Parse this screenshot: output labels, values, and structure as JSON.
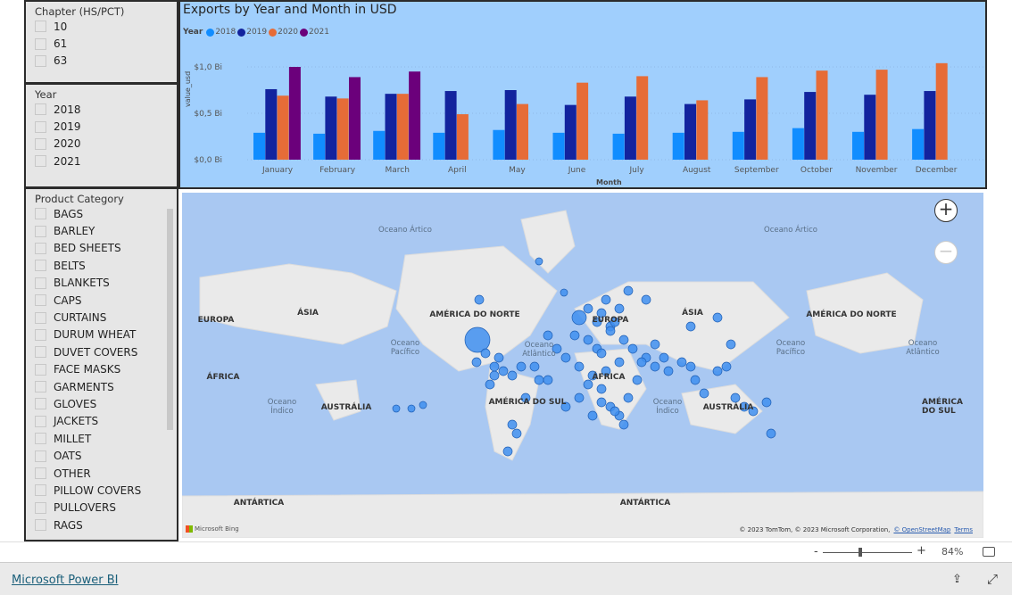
{
  "slicers": {
    "chapter": {
      "title": "Chapter (HS/PCT)",
      "items": [
        "10",
        "61",
        "63"
      ]
    },
    "year": {
      "title": "Year",
      "items": [
        "2018",
        "2019",
        "2020",
        "2021"
      ]
    },
    "product": {
      "title": "Product Category",
      "items": [
        "BAGS",
        "BARLEY",
        "BED SHEETS",
        "BELTS",
        "BLANKETS",
        "CAPS",
        "CURTAINS",
        "DURUM WHEAT",
        "DUVET COVERS",
        "FACE MASKS",
        "GARMENTS",
        "GLOVES",
        "JACKETS",
        "MILLET",
        "OATS",
        "OTHER",
        "PILLOW COVERS",
        "PULLOVERS",
        "RAGS"
      ]
    }
  },
  "chart_data": {
    "type": "bar",
    "title": "Exports by Year and Month in USD",
    "xlabel": "Month",
    "ylabel": "value_usd",
    "legend_title": "Year",
    "legend_placement": "top-left",
    "yticks": [
      "$0,0 Bi",
      "$0,5 Bi",
      "$1,0 Bi"
    ],
    "ylim": [
      0,
      1.1
    ],
    "categories": [
      "January",
      "February",
      "March",
      "April",
      "May",
      "June",
      "July",
      "August",
      "September",
      "October",
      "November",
      "December"
    ],
    "series": [
      {
        "name": "2018",
        "color": "#118dff",
        "values": [
          0.29,
          0.28,
          0.31,
          0.29,
          0.32,
          0.29,
          0.28,
          0.29,
          0.3,
          0.34,
          0.3,
          0.33
        ]
      },
      {
        "name": "2019",
        "color": "#12239e",
        "values": [
          0.76,
          0.68,
          0.71,
          0.74,
          0.75,
          0.59,
          0.68,
          0.6,
          0.65,
          0.73,
          0.7,
          0.74
        ]
      },
      {
        "name": "2020",
        "color": "#e66c37",
        "values": [
          0.69,
          0.66,
          0.71,
          0.49,
          0.6,
          0.83,
          0.9,
          0.64,
          0.89,
          0.96,
          0.97,
          1.04
        ]
      },
      {
        "name": "2021",
        "color": "#6b007b",
        "values": [
          1.0,
          0.89,
          0.95,
          null,
          null,
          null,
          null,
          null,
          null,
          null,
          null,
          null
        ]
      }
    ]
  },
  "map": {
    "labels": [
      "EUROPA",
      "ÁSIA",
      "AMÉRICA DO NORTE",
      "EUROPA",
      "ÁSIA",
      "AMÉRICA DO NORTE",
      "ÁFRICA",
      "AUSTRÁLIA",
      "AMÉRICA DO SUL",
      "ÁFRICA",
      "AUSTRÁLIA",
      "AMÉRICA DO SUL",
      "ANTÁRTICA",
      "ANTÁRTICA"
    ],
    "oceans": [
      "Oceano Ártico",
      "Oceano Ártico",
      "Oceano Pacífico",
      "Oceano Atlântico",
      "Oceano Pacífico",
      "Oceano Índico",
      "Oceano Índico",
      "Oceano Atlântico"
    ],
    "zoom_in": "+",
    "zoom_out": "−",
    "attribution": "© 2023 TomTom, © 2023 Microsoft Corporation,",
    "osm": "© OpenStreetMap",
    "terms": "Terms",
    "bing": "Microsoft Bing"
  },
  "zoom": {
    "minus": "-",
    "plus": "+",
    "percent": "84%",
    "level": 84
  },
  "footer": {
    "brand": "Microsoft Power BI"
  }
}
